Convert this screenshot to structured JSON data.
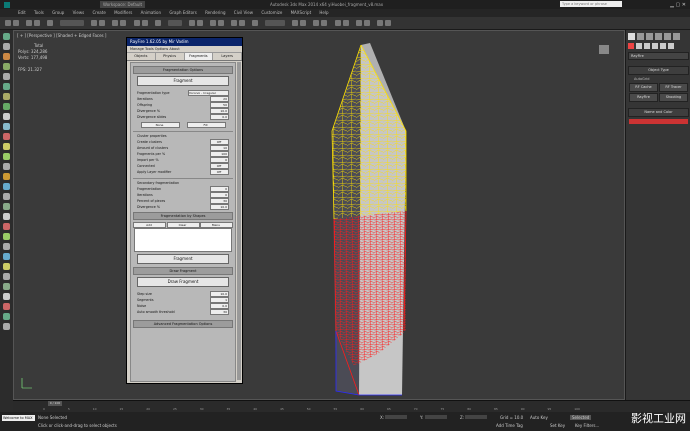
{
  "window": {
    "title": "Autodesk 3ds Max 2014 x64    yiHuobei_fragment_v8.max",
    "search_placeholder": "Type a keyword or phrase",
    "workspace": "Workspace: Default"
  },
  "menu": [
    "Edit",
    "Tools",
    "Group",
    "Views",
    "Create",
    "Modifiers",
    "Animation",
    "Graph Editors",
    "Rendering",
    "Civil View",
    "Customize",
    "MAXScript",
    "Help"
  ],
  "viewport": {
    "label": "[ + ] [Perspective ] [Shaded + Edged Faces ]",
    "stats_total_label": "Total",
    "polys_label": "Polys:",
    "polys_value": "324,286",
    "verts_label": "Verts:",
    "verts_value": "177,498",
    "fps_label": "FPS:",
    "fps_value": "21.327"
  },
  "dialog": {
    "title": "RayFire 1.62.05 by Mir Vadim",
    "menu": "Manage   Tools   Options   About",
    "tabs": [
      "Objects",
      "Physics",
      "Fragments",
      "Layers"
    ],
    "sections": {
      "frag_options": "Fragmentation Options",
      "fragment_btn": "Fragment",
      "type_label": "Fragmentation type",
      "type_value": "Voronoi - Irregular",
      "iterations_label": "Iterations",
      "iterations_value": "20",
      "offspring_label": "Offspring",
      "offspring_value": "50",
      "divergence_label": "Divergence %",
      "divergence_value": "10.0",
      "divergence_slides_label": "Divergence slides",
      "divergence_slides_value": "0.0",
      "none_btn": "None",
      "fill_btn": "Fill",
      "cluster_title": "Cluster properties",
      "create_clusters": "Create clusters",
      "create_clusters_value": "Off",
      "cluster_count_label": "Amount of clusters",
      "cluster_count_value": "10",
      "frag_per_label": "Fragments per %",
      "frag_per_value": "100",
      "seed_label": "Import per %",
      "seed_value": "0",
      "connect_label": "Connected",
      "connect_value": "Off",
      "apply_smooth_label": "Apply Layer modifier",
      "apply_smooth_value": "Off",
      "secondary_title": "Secondary fragmentation",
      "sec_frag_label": "Fragmentation",
      "sec_frag_value": "0",
      "sec_iter_label": "Iterations",
      "sec_iter_value": "0",
      "sec_perc_label": "Percent of pieces",
      "sec_perc_value": "30",
      "sec_div_label": "Divergence %",
      "sec_div_value": "10.0",
      "shapes_title": "Fragmentation by Shapes",
      "add_btn": "Add",
      "clear_btn": "Clear",
      "menu_btn": "Menu",
      "fragment_btn2": "Fragment",
      "draw_title": "Draw Fragment",
      "draw_btn": "Draw Fragment",
      "step_label": "Step size",
      "step_value": "10.0",
      "segments_label": "Segments",
      "segments_value": "1",
      "noise_label": "Noise",
      "noise_value": "0.0",
      "autosmooth_label": "Auto smooth threshold",
      "autosmooth_value": "30",
      "advanced_title": "Advanced Fragmentation Options"
    }
  },
  "right_panel": {
    "dropdown": "RayFire",
    "object_type_title": "Object Type",
    "autogrid": "AutoGrid",
    "btn1": "RF Cache",
    "btn2": "RF Tracer",
    "btn3": "RayFire",
    "btn4": "Shooting",
    "name_color_title": "Name and Color"
  },
  "timeline": {
    "frame_label": "0 / 100",
    "ticks": [
      "0",
      "5",
      "10",
      "15",
      "20",
      "25",
      "30",
      "35",
      "40",
      "45",
      "50",
      "55",
      "60",
      "65",
      "70",
      "75",
      "80",
      "85",
      "90",
      "95",
      "100"
    ]
  },
  "status": {
    "maxscript": "Welcome to MAX",
    "selected": "None Selected",
    "prompt": "Click or click-and-drag to select objects",
    "x_label": "X:",
    "y_label": "Y:",
    "z_label": "Z:",
    "grid": "Grid = 10.0",
    "autokey": "Auto Key",
    "setkey": "Set Key",
    "selected_btn": "Selected",
    "key_filters": "Key Filters...",
    "add_time_tag": "Add Time Tag"
  },
  "watermark": "影视工业网",
  "colors": {
    "accent": "#0a246a",
    "red": "#ff1a1a",
    "yellow": "#ffe100",
    "blue": "#2a2aff"
  }
}
